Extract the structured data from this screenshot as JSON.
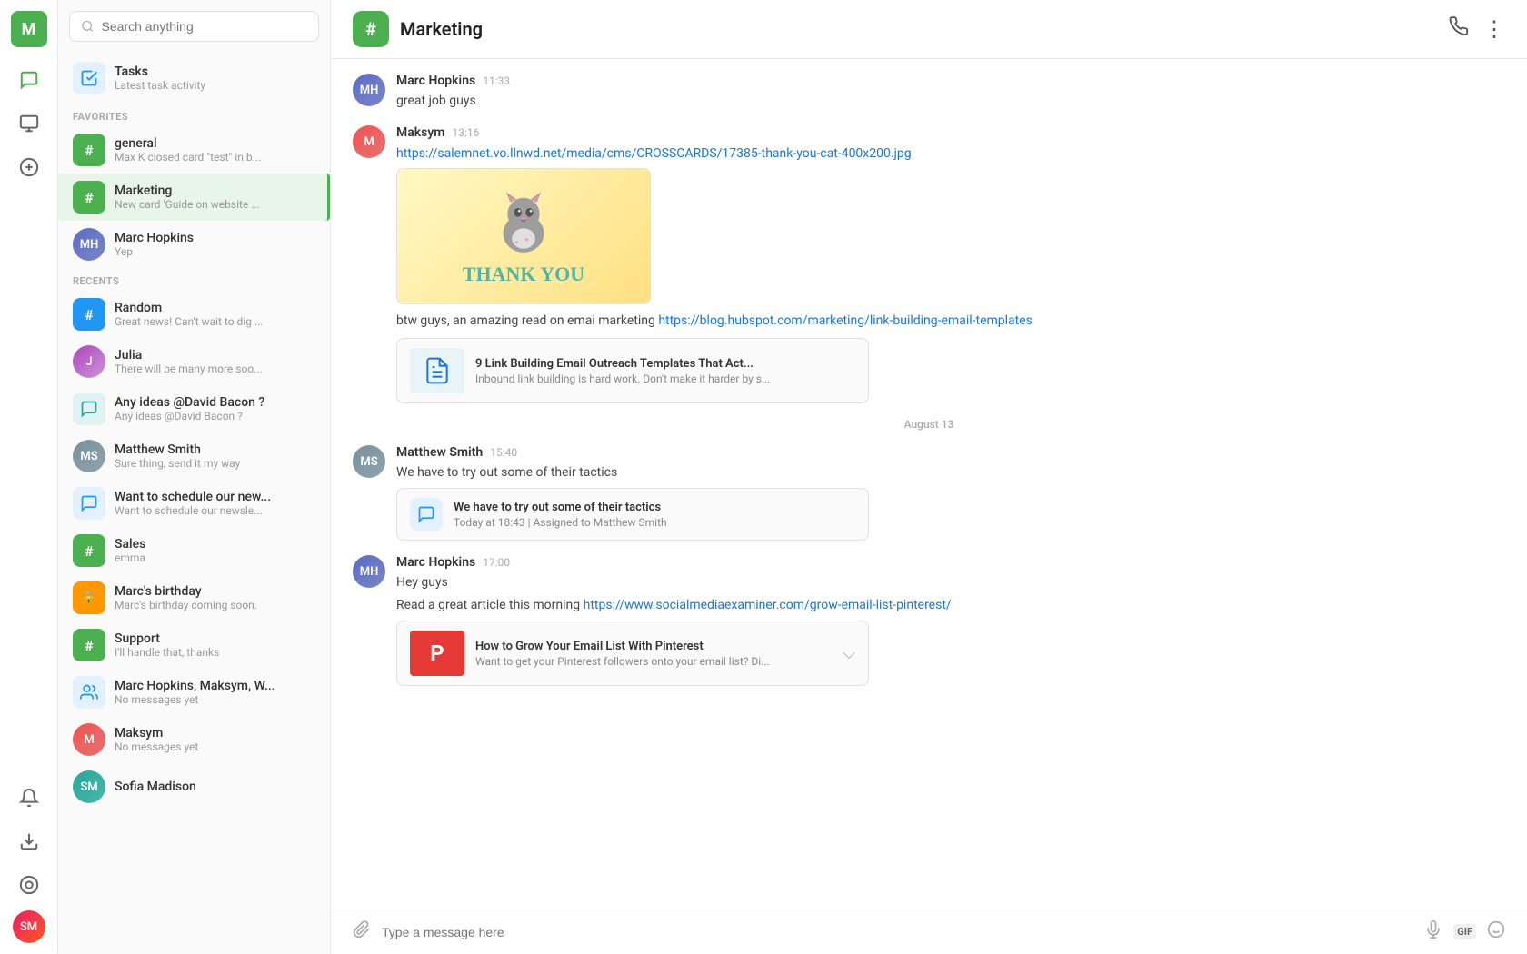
{
  "app": {
    "user_initial": "M",
    "title": "Marketing"
  },
  "nav": {
    "chat_label": "Chat",
    "contacts_label": "Contacts",
    "add_label": "Add",
    "notifications_label": "Notifications",
    "download_label": "Download",
    "games_label": "Games"
  },
  "search": {
    "placeholder": "Search anything"
  },
  "tasks": {
    "title": "Tasks",
    "subtitle": "Latest task activity"
  },
  "sections": {
    "favorites": "FAVORITES",
    "recents": "RECENTS"
  },
  "favorites": [
    {
      "id": "general",
      "name": "general",
      "preview": "Max K closed card \"test\" in b...",
      "type": "channel",
      "color": "green"
    },
    {
      "id": "marketing",
      "name": "Marketing",
      "preview": "New card 'Guide on website ...",
      "type": "channel",
      "color": "green",
      "active": true
    },
    {
      "id": "marc-hopkins",
      "name": "Marc Hopkins",
      "preview": "Yep",
      "type": "person"
    }
  ],
  "recents": [
    {
      "id": "random",
      "name": "Random",
      "preview": "Great news! Can't wait to dig ...",
      "type": "channel",
      "color": "blue"
    },
    {
      "id": "julia",
      "name": "Julia",
      "preview": "There will be many more soo...",
      "type": "person"
    },
    {
      "id": "david-bacon",
      "name": "Any ideas @David Bacon ?",
      "preview": "Any ideas @David Bacon ?",
      "type": "icon-teal"
    },
    {
      "id": "matthew-smith",
      "name": "Matthew Smith",
      "preview": "Sure thing, send it my way",
      "type": "person"
    },
    {
      "id": "newsletter",
      "name": "Want to schedule our new...",
      "preview": "Want to schedule our newsle...",
      "type": "icon-blue"
    },
    {
      "id": "sales",
      "name": "Sales",
      "preview": "emma",
      "type": "channel",
      "color": "green"
    },
    {
      "id": "marcs-birthday",
      "name": "Marc's birthday",
      "preview": "Marc's birthday coming soon.",
      "type": "channel",
      "color": "orange"
    },
    {
      "id": "support",
      "name": "Support",
      "preview": "I'll handle that, thanks",
      "type": "channel",
      "color": "orange"
    },
    {
      "id": "group-chat",
      "name": "Marc Hopkins, Maksym, W...",
      "preview": "No messages yet",
      "type": "icon-blue"
    },
    {
      "id": "maksym",
      "name": "Maksym",
      "preview": "No messages yet",
      "type": "person"
    },
    {
      "id": "sofia-madison",
      "name": "Sofia Madison",
      "preview": "",
      "type": "person"
    }
  ],
  "messages": [
    {
      "id": "msg1",
      "sender": "Marc Hopkins",
      "time": "11:33",
      "text": "great job guys",
      "type": "text"
    },
    {
      "id": "msg2",
      "sender": "Maksym",
      "time": "13:16",
      "link": "https://salemnet.vo.llnwd.net/media/cms/CROSSCARDS/17385-thank-you-cat-400x200.jpg",
      "has_image": true,
      "image_text": "THANK   YOU",
      "body_text": "btw guys, an amazing read on emai marketing",
      "body_link": "https://blog.hubspot.com/marketing/link-building-email-templates",
      "preview_title": "9 Link Building Email Outreach Templates That Act...",
      "preview_desc": "Inbound link building is hard work. Don't make it harder by s...",
      "type": "complex"
    }
  ],
  "date_divider": "August 13",
  "messages2": [
    {
      "id": "msg3",
      "sender": "Matthew Smith",
      "time": "15:40",
      "text": "We have to try out some of their tactics",
      "task_title": "We have to try out some of their tactics",
      "task_sub": "Today at 18:43 | Assigned to Matthew Smith",
      "type": "with_task"
    },
    {
      "id": "msg4",
      "sender": "Marc Hopkins",
      "time": "17:00",
      "text": "Hey guys",
      "body_text": "Read a great article this morning",
      "body_link": "https://www.socialmediaexaminer.com/grow-email-list-pinterest/",
      "preview_title": "How to Grow Your Email List With Pinterest",
      "preview_desc": "Want to get your Pinterest followers onto your email list? Di...",
      "type": "complex2"
    }
  ],
  "footer": {
    "placeholder": "Type a message here"
  },
  "header_actions": {
    "phone": "📞",
    "more": "⋮"
  }
}
